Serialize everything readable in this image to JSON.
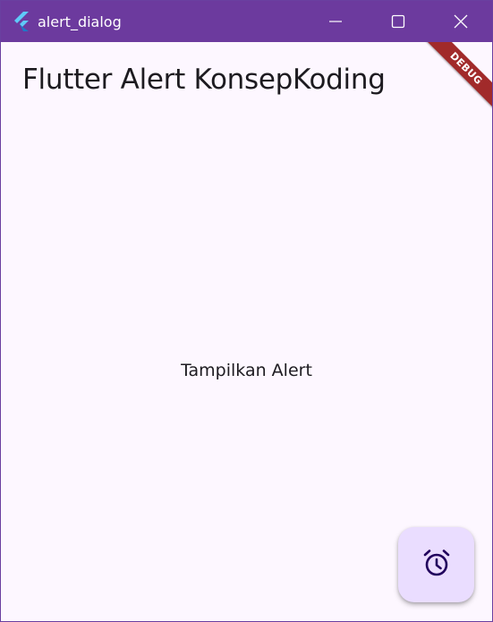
{
  "window": {
    "title": "alert_dialog",
    "titlebar_color": "#6c3a9e",
    "controls": {
      "minimize_icon": "minimize-icon",
      "maximize_icon": "maximize-icon",
      "close_icon": "close-icon"
    }
  },
  "app_bar": {
    "title": "Flutter Alert KonsepKoding"
  },
  "debug_banner": {
    "label": "DEBUG",
    "color": "#a12a2a"
  },
  "body": {
    "center_text": "Tampilkan Alert"
  },
  "fab": {
    "icon": "alarm-icon",
    "background": "#eaddff"
  },
  "colors": {
    "background": "#fdf7ff",
    "text": "#1d1b20"
  }
}
